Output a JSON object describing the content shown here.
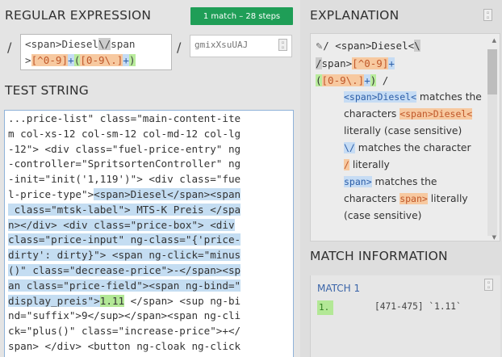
{
  "regex_panel": {
    "title": "REGULAR EXPRESSION",
    "match_badge": "1 match – 28 steps",
    "open_delim": "/",
    "close_delim": "/",
    "regex_parts": [
      "<span>Diesel",
      "\\/",
      "span",
      ">",
      "[^0-9]",
      "+",
      "(",
      "[0-9\\.]",
      "+",
      ")"
    ],
    "flags_placeholder": "gmixXsuUAJ"
  },
  "test_panel": {
    "title": "TEST STRING",
    "lines": [
      [
        "...price-list\" class=\"main-content-ite",
        ""
      ],
      [
        "m col-xs-12 col-sm-12 col-md-12 col-lg",
        ""
      ],
      [
        "-12\"> <div class=\"fuel-price-entry\" ng",
        ""
      ],
      [
        "-controller=\"SpritsortenController\" ng",
        ""
      ],
      [
        "-init=\"init('1,119')\"> <div class=\"fue",
        ""
      ],
      [
        "l-price-type\">",
        "<span>Diesel</span><span"
      ],
      [
        "",
        " class=\"mtsk-label\"> MTS-K Preis </spa"
      ],
      [
        "",
        "n></div> <div class=\"price-box\"> <div"
      ],
      [
        "",
        "class=\"price-input\" ng-class=\"{'price-"
      ],
      [
        "",
        "dirty': dirty}\"> <span ng-click=\"minus"
      ],
      [
        "",
        "()\" class=\"decrease-price\">-</span><sp"
      ],
      [
        "",
        "an class=\"price-field\"><span ng-bind=\""
      ],
      [
        "",
        "display_preis\">"
      ]
    ],
    "match_value": "1.11",
    "after_match": " </span> <sup ng-bi",
    "tail_lines": [
      "nd=\"suffix\">9</sup></span><span ng-cli",
      "ck=\"plus()\" class=\"increase-price\">+</",
      "span> </div> <button ng-cloak ng-click",
      "=\"m..."
    ]
  },
  "explanation_panel": {
    "title": "EXPLANATION",
    "regex_line1_prefix": "/ ",
    "regex_line1_literal": "<span>Diesel<",
    "regex_line1_escape": "\\",
    "regex_line2_escape": "/",
    "regex_line2_literal": "span>",
    "regex_line2_class": "[^0-9]",
    "regex_line2_plus": "+",
    "regex_line3_group_open": "(",
    "regex_line3_class": "[0-9\\.]",
    "regex_line3_plus": "+",
    "regex_line3_group_close": ")",
    "regex_line3_suffix": " /",
    "items": [
      {
        "token": "<span>Diesel<",
        "text1": " matches the",
        "text2_prefix": "characters ",
        "text2_token": "<span>Diesel<",
        "text3": "literally (case sensitive)"
      },
      {
        "token": "\\/",
        "text1": " matches the character",
        "text2_token": "/",
        "text2_suffix": " literally"
      },
      {
        "token": "span>",
        "text1": " matches the",
        "text2_prefix": "characters ",
        "text2_token": "span>",
        "text2_suffix": " literally",
        "text3": "(case sensitive)"
      }
    ]
  },
  "match_info_panel": {
    "title": "MATCH INFORMATION",
    "match_label": "MATCH 1",
    "group_num": "1.",
    "group_range": "[471-475] `1.11`"
  },
  "icons": [
    "tiny-copy-icon",
    "collapse-icon",
    "scroll-up-icon",
    "scroll-down-icon"
  ]
}
